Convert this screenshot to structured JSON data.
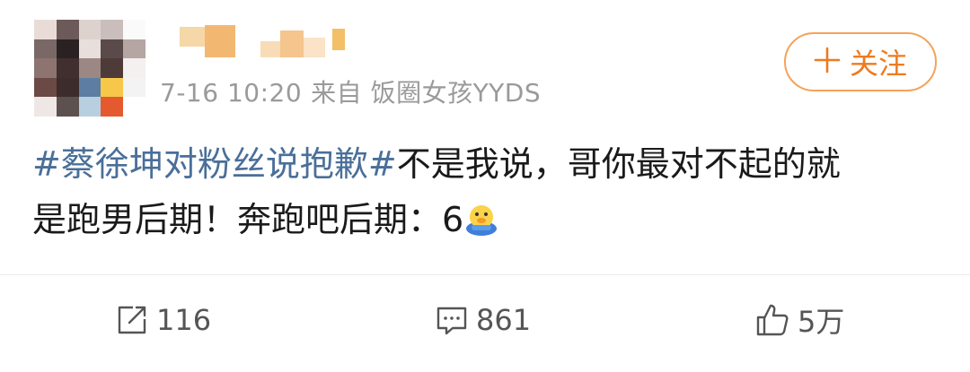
{
  "post": {
    "meta": {
      "time": "7-16 10:20",
      "source_prefix": "来自",
      "source_name": "饭圈女孩YYDS"
    },
    "follow_button": {
      "icon": "plus-icon",
      "label": "关注"
    },
    "content": {
      "hashtag": "#蔡徐坤对粉丝说抱歉#",
      "text_line1": "不是我说，哥你最对不起的就",
      "text_line2": "是跑男后期！奔跑吧后期：6",
      "emoji": "duck-emoji"
    },
    "actions": {
      "repost": {
        "icon": "share-icon",
        "count": "116"
      },
      "comment": {
        "icon": "comment-icon",
        "count": "861"
      },
      "like": {
        "icon": "thumbs-up-icon",
        "count": "5万"
      }
    }
  },
  "colors": {
    "hashtag": "#4a6f99",
    "follow_accent": "#ee7a1e",
    "meta_gray": "#9a9a9a"
  }
}
